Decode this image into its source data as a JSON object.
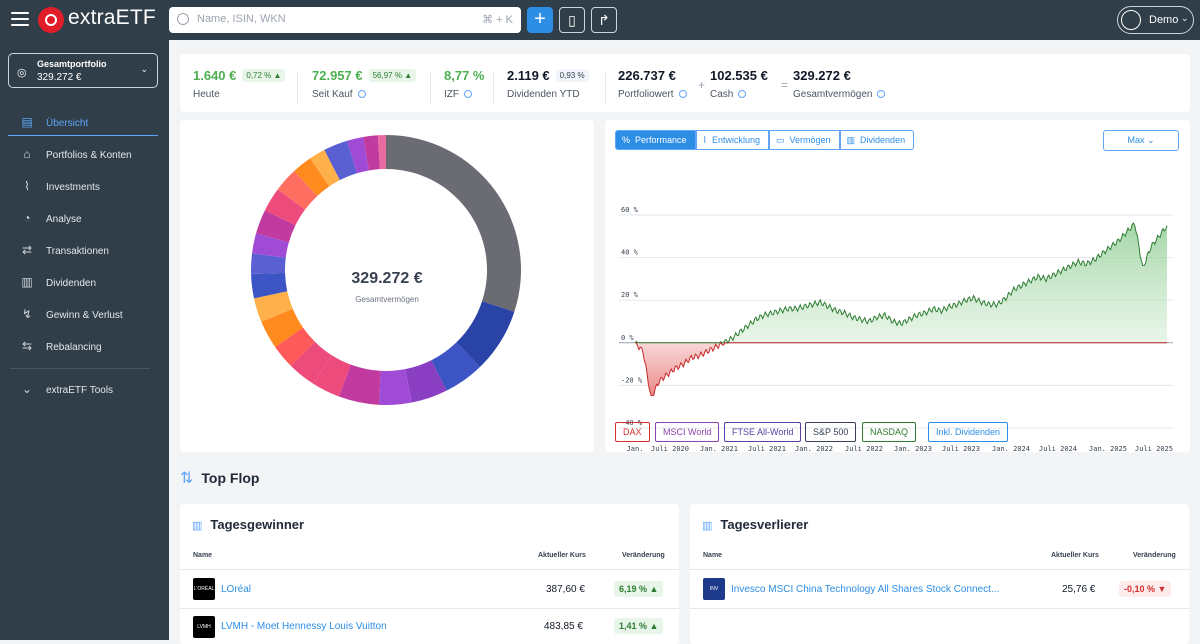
{
  "app": {
    "brand": "extraETF"
  },
  "search": {
    "placeholder": "Name, ISIN, WKN",
    "shortcut": "⌘ + K"
  },
  "user": {
    "name": "Demo"
  },
  "portfolio": {
    "name": "Gesamtportfolio",
    "value": "329.272 €"
  },
  "sidebar": {
    "items": [
      {
        "label": "Übersicht"
      },
      {
        "label": "Portfolios & Konten"
      },
      {
        "label": "Investments"
      },
      {
        "label": "Analyse"
      },
      {
        "label": "Transaktionen"
      },
      {
        "label": "Dividenden"
      },
      {
        "label": "Gewinn & Verlust"
      },
      {
        "label": "Rebalancing"
      },
      {
        "label": "extraETF Tools"
      }
    ]
  },
  "kpis": {
    "heute": {
      "value": "1.640 €",
      "badge": "0,72 % ▲",
      "label": "Heute"
    },
    "seit_kauf": {
      "value": "72.957 €",
      "badge": "56,97 % ▲",
      "label": "Seit Kauf"
    },
    "izf": {
      "value": "8,77 %",
      "label": "IZF"
    },
    "dividenden": {
      "value": "2.119 €",
      "badge": "0,93 %",
      "label": "Dividenden YTD"
    },
    "portfoliowert": {
      "value": "226.737 €",
      "label": "Portfoliowert"
    },
    "cash": {
      "value": "102.535 €",
      "label": "Cash"
    },
    "gesamt": {
      "value": "329.272 €",
      "label": "Gesamtvermögen"
    }
  },
  "donut": {
    "center_value": "329.272 €",
    "center_label": "Gesamtvermögen",
    "colors": {
      "gray": "#6b6b73",
      "navy": "#2a43a6",
      "blue": "#3d55c4",
      "purple": "#8a3fc2",
      "magenta": "#c03aa0",
      "pink": "#ee4b7d",
      "orange": "#ff8a1e",
      "light_orange": "#ffb04a",
      "indigo": "#5a5fd1",
      "violet": "#a04bd6"
    }
  },
  "chart_tabs": [
    {
      "label": "Performance"
    },
    {
      "label": "Entwicklung"
    },
    {
      "label": "Vermögen"
    },
    {
      "label": "Dividenden"
    }
  ],
  "range_select": {
    "label": "Max"
  },
  "benchmarks": [
    {
      "label": "DAX",
      "color": "#d32f2f"
    },
    {
      "label": "MSCI World",
      "color": "#8e44ad"
    },
    {
      "label": "FTSE All-World",
      "color": "#5b3fa6"
    },
    {
      "label": "S&P 500",
      "color": "#374151"
    },
    {
      "label": "NASDAQ",
      "color": "#2e7d32"
    },
    {
      "label": "Inkl. Dividenden",
      "color": "#2d8ee6"
    }
  ],
  "chart_data": {
    "type": "area",
    "ylim": [
      -40,
      60
    ],
    "y_ticks": [
      "60 %",
      "40 %",
      "20 %",
      "0 %",
      "-20 %",
      "-40 %"
    ],
    "x_ticks": [
      "Jan.",
      "Juli 2020",
      "Jan. 2021",
      "Juli 2021",
      "Jan. 2022",
      "Juli 2022",
      "Jan. 2023",
      "Juli 2023",
      "Jan. 2024",
      "Juli 2024",
      "Jan. 2025",
      "Juli 2025"
    ],
    "series": [
      {
        "x": [
          "Jan. 2020",
          "Feb. 2020",
          "März 2020",
          "Apr. 2020",
          "Mai 2020",
          "Juni 2020",
          "Juli 2020",
          "Aug. 2020",
          "Sep. 2020",
          "Okt. 2020",
          "Nov. 2020",
          "Dez. 2020",
          "Jan. 2021",
          "Feb. 2021",
          "März 2021",
          "Apr. 2021",
          "Mai 2021",
          "Juni 2021",
          "Juli 2021",
          "Aug. 2021",
          "Sep. 2021",
          "Okt. 2021",
          "Nov. 2021",
          "Dez. 2021",
          "Jan. 2022",
          "Feb. 2022",
          "März 2022",
          "Apr. 2022",
          "Mai 2022",
          "Juni 2022",
          "Juli 2022",
          "Aug. 2022",
          "Sep. 2022",
          "Okt. 2022",
          "Nov. 2022",
          "Dez. 2022",
          "Jan. 2023",
          "Feb. 2023",
          "März 2023",
          "Apr. 2023",
          "Mai 2023",
          "Juni 2023",
          "Juli 2023",
          "Aug. 2023",
          "Sep. 2023",
          "Okt. 2023",
          "Nov. 2023",
          "Dez. 2023",
          "Jan. 2024",
          "Feb. 2024",
          "März 2024",
          "Apr. 2024",
          "Mai 2024",
          "Juni 2024",
          "Juli 2024",
          "Aug. 2024",
          "Sep. 2024",
          "Okt. 2024",
          "Nov. 2024",
          "Dez. 2024",
          "Jan. 2025",
          "Feb. 2025",
          "März 2025",
          "Apr. 2025",
          "Mai 2025",
          "Juni 2025",
          "Juli 2025"
        ],
        "y": [
          0,
          -4,
          -26,
          -18,
          -15,
          -12,
          -10,
          -7,
          -6,
          -4,
          -2,
          0,
          2,
          5,
          8,
          11,
          13,
          14,
          15,
          16,
          16,
          17,
          18,
          19,
          17,
          15,
          14,
          12,
          11,
          10,
          12,
          13,
          10,
          9,
          11,
          13,
          14,
          16,
          15,
          17,
          18,
          20,
          21,
          19,
          18,
          18,
          21,
          25,
          27,
          29,
          31,
          30,
          32,
          34,
          36,
          38,
          37,
          39,
          42,
          45,
          48,
          52,
          56,
          35,
          45,
          50,
          55
        ]
      }
    ]
  },
  "top_flop": {
    "title": "Top Flop",
    "gainers": {
      "title": "Tagesgewinner",
      "col_name": "Name",
      "col_price": "Aktueller Kurs",
      "col_change": "Veränderung",
      "rows": [
        {
          "logo": "L'ORÉAL",
          "name": "LOréal",
          "price": "387,60 €",
          "change": "6,19 % ▲"
        },
        {
          "logo": "LVMH",
          "name": "LVMH - Moet Hennessy Louis Vuitton",
          "price": "483,85 €",
          "change": "1,41 % ▲"
        }
      ]
    },
    "losers": {
      "title": "Tagesverlierer",
      "col_name": "Name",
      "col_price": "Aktueller Kurs",
      "col_change": "Veränderung",
      "rows": [
        {
          "logo": "INV",
          "name": "Invesco MSCI China Technology All Shares Stock Connect...",
          "price": "25,76 €",
          "change": "-0,10 % ▼"
        }
      ]
    }
  }
}
